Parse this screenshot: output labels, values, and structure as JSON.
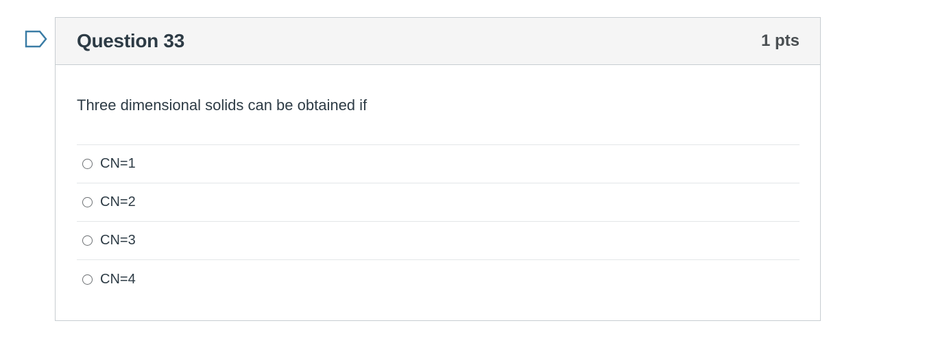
{
  "question": {
    "title": "Question 33",
    "points": "1 pts",
    "text": "Three dimensional solids can be obtained if",
    "flag_icon": "bookmark-flag-icon",
    "answers": [
      {
        "label": "CN=1",
        "selected": false
      },
      {
        "label": "CN=2",
        "selected": false
      },
      {
        "label": "CN=3",
        "selected": false
      },
      {
        "label": "CN=4",
        "selected": false
      }
    ]
  },
  "colors": {
    "header_bg": "#f5f5f5",
    "border": "#c7cdd1",
    "text": "#2d3b45",
    "flag": "#3a7ca5"
  }
}
